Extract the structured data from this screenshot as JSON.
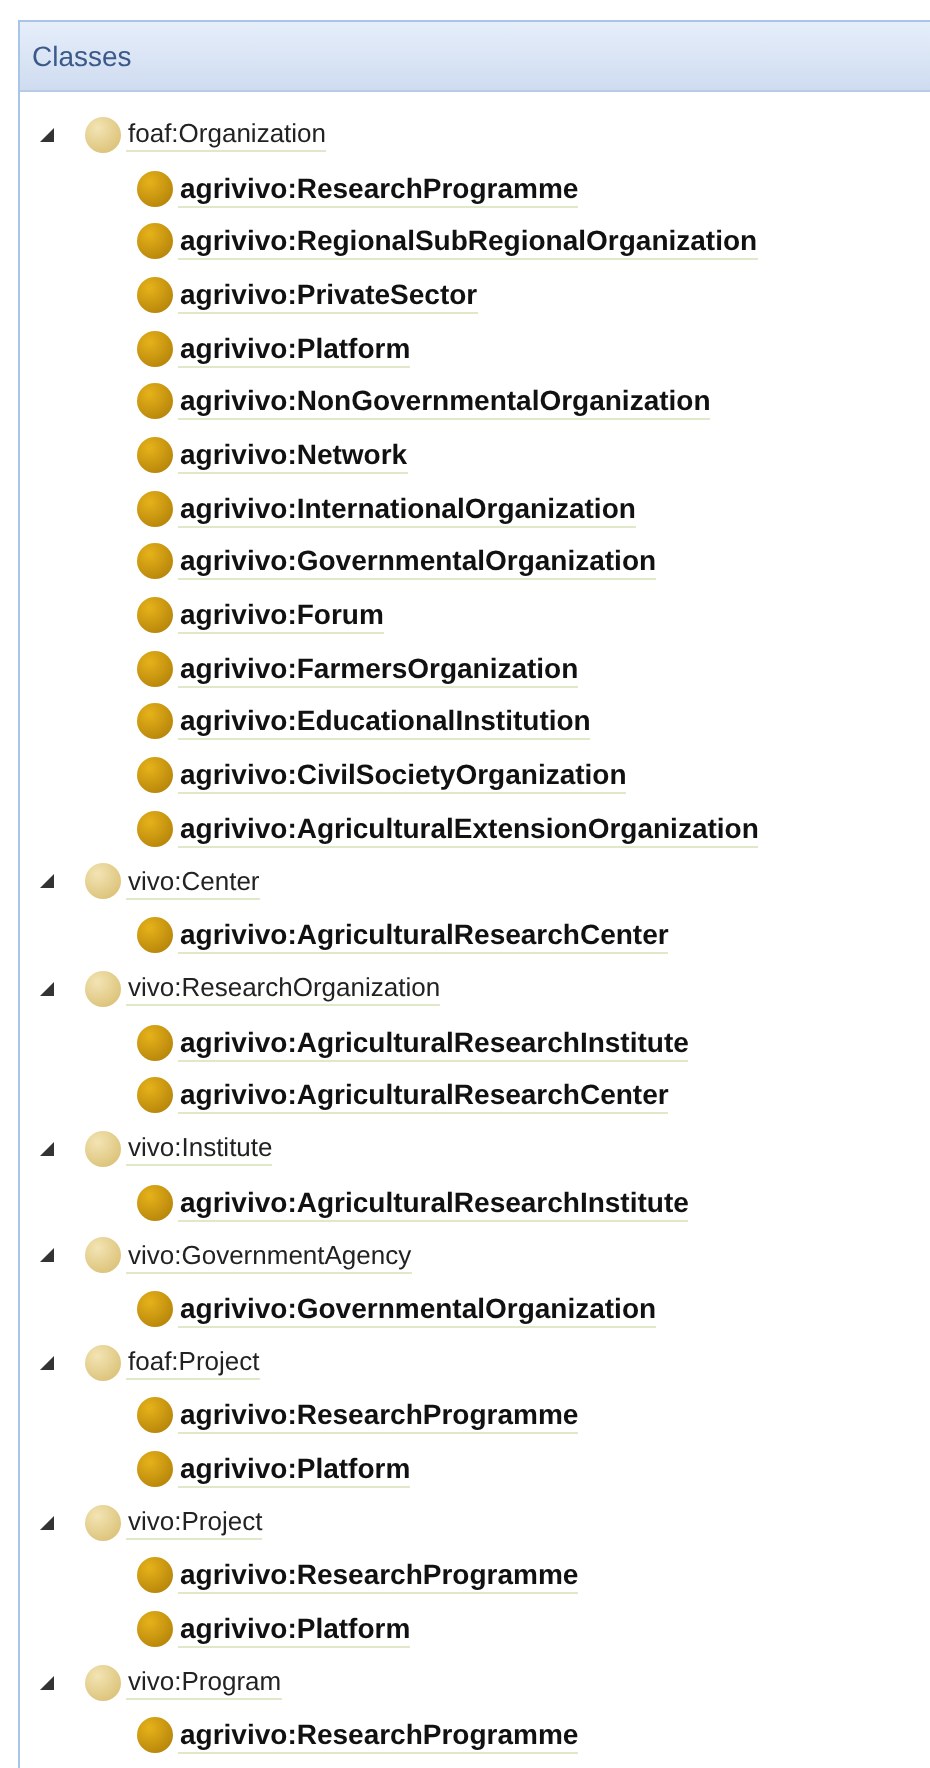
{
  "panel": {
    "title": "Classes"
  },
  "tree": [
    {
      "label": "foaf:Organization",
      "expanded": true,
      "children": [
        {
          "label": "agrivivo:ResearchProgramme"
        },
        {
          "label": "agrivivo:RegionalSubRegionalOrganization"
        },
        {
          "label": "agrivivo:PrivateSector"
        },
        {
          "label": "agrivivo:Platform"
        },
        {
          "label": "agrivivo:NonGovernmentalOrganization"
        },
        {
          "label": "agrivivo:Network"
        },
        {
          "label": "agrivivo:InternationalOrganization"
        },
        {
          "label": "agrivivo:GovernmentalOrganization"
        },
        {
          "label": "agrivivo:Forum"
        },
        {
          "label": "agrivivo:FarmersOrganization"
        },
        {
          "label": "agrivivo:EducationalInstitution"
        },
        {
          "label": "agrivivo:CivilSocietyOrganization"
        },
        {
          "label": "agrivivo:AgriculturalExtensionOrganization"
        }
      ]
    },
    {
      "label": "vivo:Center",
      "expanded": true,
      "children": [
        {
          "label": "agrivivo:AgriculturalResearchCenter"
        }
      ]
    },
    {
      "label": "vivo:ResearchOrganization",
      "expanded": true,
      "children": [
        {
          "label": "agrivivo:AgriculturalResearchInstitute"
        },
        {
          "label": "agrivivo:AgriculturalResearchCenter"
        }
      ]
    },
    {
      "label": "vivo:Institute",
      "expanded": true,
      "children": [
        {
          "label": "agrivivo:AgriculturalResearchInstitute"
        }
      ]
    },
    {
      "label": "vivo:GovernmentAgency",
      "expanded": true,
      "children": [
        {
          "label": "agrivivo:GovernmentalOrganization"
        }
      ]
    },
    {
      "label": "foaf:Project",
      "expanded": true,
      "children": [
        {
          "label": "agrivivo:ResearchProgramme"
        },
        {
          "label": "agrivivo:Platform"
        }
      ]
    },
    {
      "label": "vivo:Project",
      "expanded": true,
      "children": [
        {
          "label": "agrivivo:ResearchProgramme"
        },
        {
          "label": "agrivivo:Platform"
        }
      ]
    },
    {
      "label": "vivo:Program",
      "expanded": true,
      "children": [
        {
          "label": "agrivivo:ResearchProgramme"
        }
      ]
    }
  ]
}
